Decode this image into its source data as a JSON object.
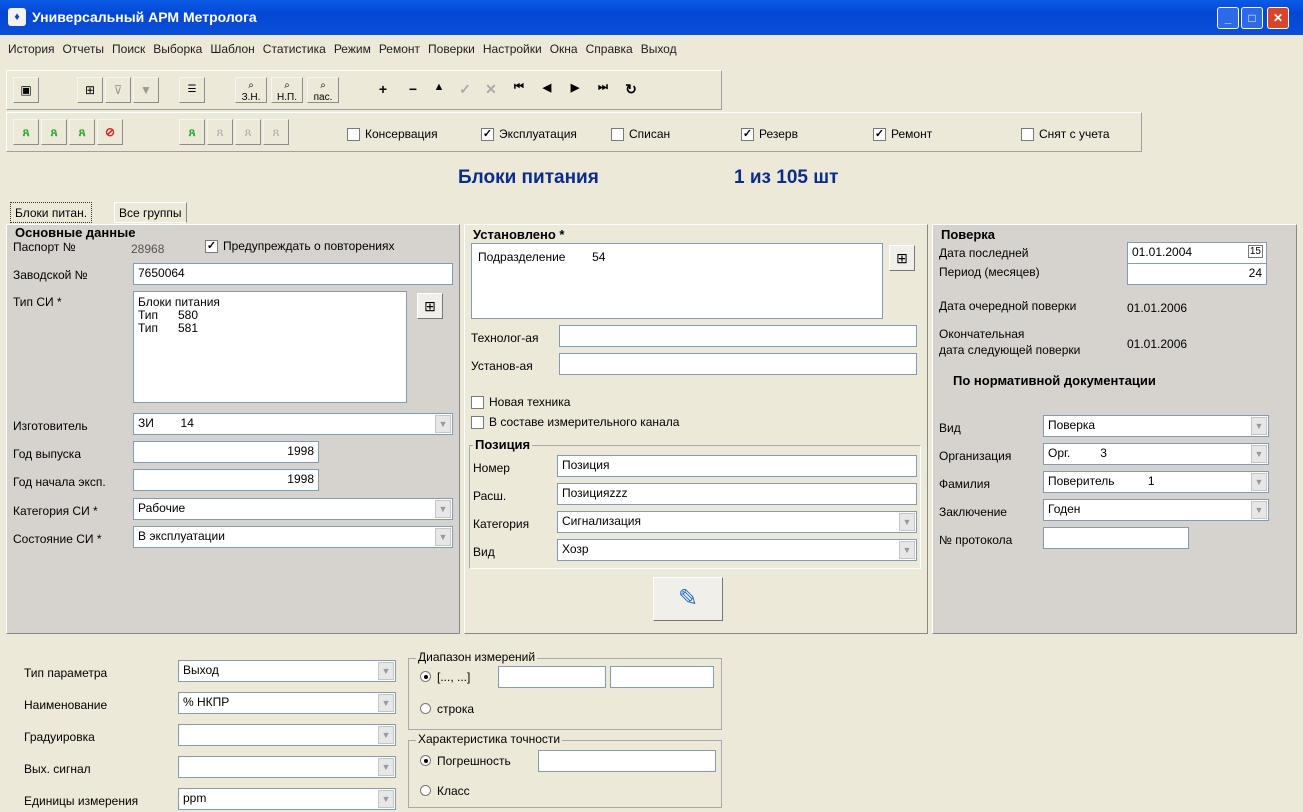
{
  "window": {
    "title": "Универсальный АРМ Метролога"
  },
  "menu": [
    "История",
    "Отчеты",
    "Поиск",
    "Выборка",
    "Шаблон",
    "Статистика",
    "Режим",
    "Ремонт",
    "Поверки",
    "Настройки",
    "Окна",
    "Справка",
    "Выход"
  ],
  "toolbar": {
    "btn_zn": "З.Н.",
    "btn_np": "Н.П.",
    "btn_pas": "пас."
  },
  "filters": [
    {
      "label": "Консервация",
      "checked": false
    },
    {
      "label": "Эксплуатация",
      "checked": true
    },
    {
      "label": "Списан",
      "checked": false
    },
    {
      "label": "Резерв",
      "checked": true
    },
    {
      "label": "Ремонт",
      "checked": true
    },
    {
      "label": "Снят с учета",
      "checked": false
    }
  ],
  "header": {
    "title": "Блоки питания",
    "counter": "1 из 105 шт"
  },
  "tabs": [
    "Блоки питан.",
    "Все группы"
  ],
  "basic": {
    "title": "Основные данные",
    "passport_label": "Паспорт №",
    "passport_value": "28968",
    "warn_label": "Предупреждать о повторениях",
    "serial_label": "Заводской №",
    "serial_value": "7650064",
    "type_label": "Тип СИ *",
    "type_lines": [
      "Блоки питания",
      "Тип      580",
      "Тип      581"
    ],
    "maker_label": "Изготовитель",
    "maker_value": "ЗИ        14",
    "year_label": "Год выпуска",
    "year_value": "1998",
    "start_label": "Год начала эксп.",
    "start_value": "1998",
    "cat_label": "Категория СИ *",
    "cat_value": "Рабочие",
    "state_label": "Состояние СИ *",
    "state_value": "В эксплуатации"
  },
  "installed": {
    "title": "Установлено *",
    "dept": "Подразделение        54",
    "tech_label": "Технолог-ая",
    "inst_label": "Установ-ая",
    "new_label": "Новая техника",
    "chan_label": "В составе измерительного канала"
  },
  "position": {
    "title": "Позиция",
    "num_label": "Номер",
    "num_value": "Позиция",
    "ras_label": "Расш.",
    "ras_value": "Позицияzzz",
    "cat_label": "Категория",
    "cat_value": "Сигнализация",
    "kind_label": "Вид",
    "kind_value": "Хозр"
  },
  "verify": {
    "title": "Поверка",
    "last_label": "Дата последней",
    "last_value": "01.01.2004",
    "period_label": "Период (месяцев)",
    "period_value": "24",
    "next_label": "Дата очередной поверки",
    "next_value": "01.01.2006",
    "final_label1": "Окончательная",
    "final_label2": "дата следующей поверки",
    "final_value": "01.01.2006",
    "norm_title": "По нормативной документации",
    "kind_label": "Вид",
    "kind_value": "Поверка",
    "org_label": "Организация",
    "org_value": "Орг.         3",
    "name_label": "Фамилия",
    "name_value": "Поверитель          1",
    "concl_label": "Заключение",
    "concl_value": "Годен",
    "proto_label": "№ протокола"
  },
  "params": {
    "ptype_label": "Тип параметра",
    "ptype_value": "Выход",
    "pname_label": "Наименование",
    "pname_value": "% НКПР",
    "grad_label": "Градуировка",
    "out_label": "Вых. сигнал",
    "unit_label": "Единицы измерения",
    "unit_value": "ppm",
    "range_title": "Диапазон измерений",
    "range_opt1": "[..., ...]",
    "range_opt2": "строка",
    "acc_title": "Характеристика точности",
    "acc_opt1": "Погрешность",
    "acc_opt2": "Класс"
  }
}
